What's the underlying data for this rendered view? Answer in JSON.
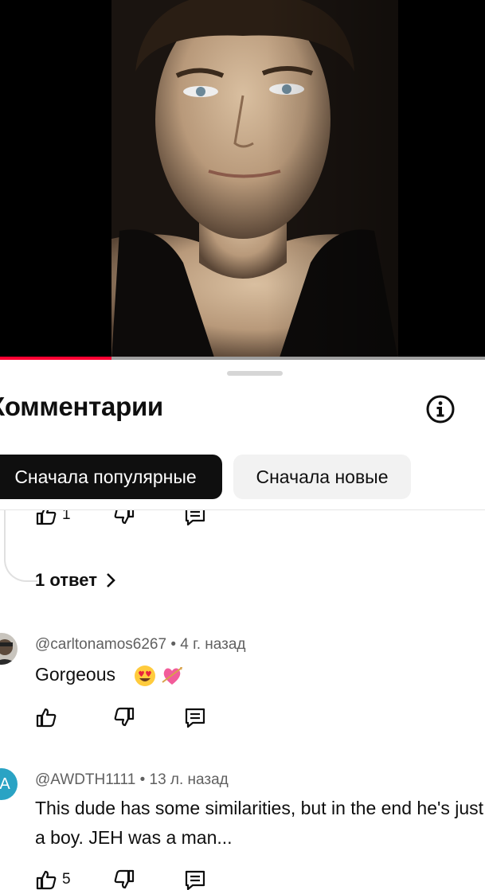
{
  "video": {
    "progress_fraction": 0.23
  },
  "sheet": {
    "title": "Комментарии",
    "sort_chips": [
      {
        "label": "Сначала популярные",
        "active": true
      },
      {
        "label": "Сначала новые",
        "active": false
      }
    ]
  },
  "prev_comment": {
    "like_count": "1",
    "replies_label": "1 ответ"
  },
  "comments": [
    {
      "author": "@carltonamos6267",
      "time": "4 г. назад",
      "text": "Gorgeous",
      "emojis": [
        "smiling-face-heart-eyes",
        "heart-with-arrow"
      ],
      "like_count": ""
    },
    {
      "author": "@AWDTH1111",
      "time": "13 л. назад",
      "text": "This dude has some similarities, but in the end he's just a boy. JEH was a man...",
      "avatar_letter": "A",
      "avatar_color": "#2aa3c4",
      "like_count": "5"
    }
  ],
  "colors": {
    "accent": "#ff0033",
    "chip_active_bg": "#0f0f0f",
    "chip_inactive_bg": "#f2f2f2"
  }
}
